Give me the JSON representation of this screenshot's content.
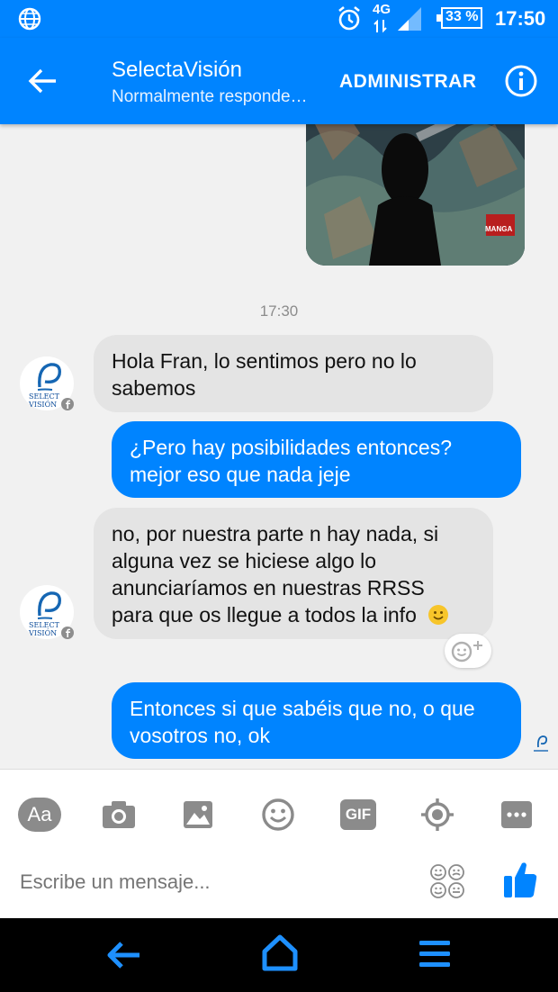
{
  "status_bar": {
    "network": "4G",
    "battery": "33 %",
    "time": "17:50"
  },
  "header": {
    "title": "SelectaVisión",
    "subtitle": "Normalmente responde…",
    "action_label": "ADMINISTRAR"
  },
  "chat": {
    "timestamp": "17:30",
    "messages": [
      {
        "from": "page",
        "lines": [
          "Hola Fran, lo sentimos pero no lo",
          "sabemos"
        ]
      },
      {
        "from": "me",
        "lines": [
          "¿Pero hay posibilidades entonces?",
          "mejor eso que nada jeje"
        ]
      },
      {
        "from": "page",
        "lines": [
          "no, por nuestra parte n hay nada, si",
          "alguna vez se hiciese algo lo",
          "anunciaríamos en nuestras RRSS",
          "para que os llegue a todos la info"
        ]
      },
      {
        "from": "me",
        "lines": [
          "Entonces si que sabéis que no, o que",
          "vosotros no, ok"
        ]
      }
    ],
    "avatar_text": [
      "SELECT",
      "VISIÓN"
    ],
    "image_badge": "MANGA"
  },
  "composer": {
    "text_button": "Aa",
    "gif_label": "GIF",
    "placeholder": "Escribe un mensaje..."
  },
  "colors": {
    "brand": "#0084ff",
    "incoming_bubble": "#e4e4e4",
    "nav_icons": "#1e90ff"
  }
}
